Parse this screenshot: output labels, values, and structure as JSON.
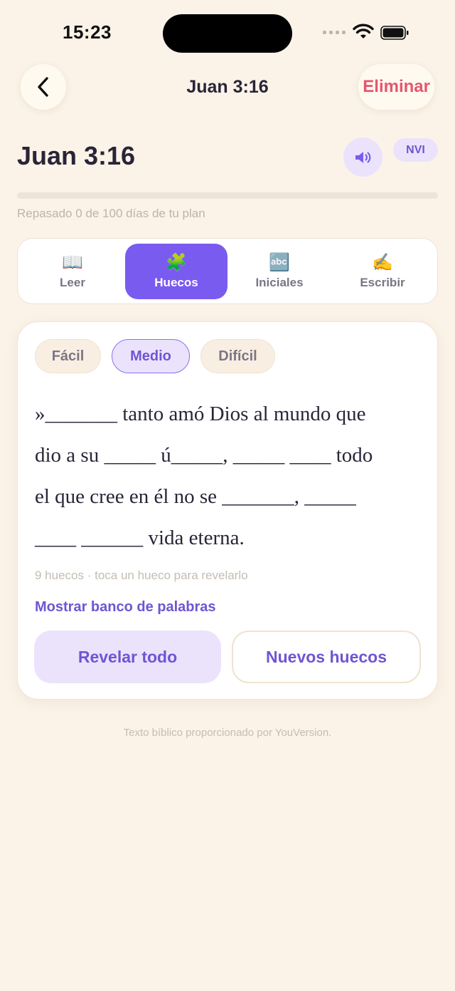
{
  "status_bar": {
    "time": "15:23"
  },
  "nav": {
    "title": "Juan 3:16",
    "delete_label": "Eliminar"
  },
  "heading": {
    "reference": "Juan 3:16",
    "version_badge": "NVI",
    "audio_icon": "speaker-icon"
  },
  "progress": {
    "reviewed_days": 0,
    "total_days": 100,
    "fraction": 0,
    "text": "Repasado 0 de 100 días de tu plan"
  },
  "mode_tabs": [
    {
      "icon": "📖",
      "icon_name": "book-icon",
      "label": "Leer",
      "active": false
    },
    {
      "icon": "🧩",
      "icon_name": "puzzle-icon",
      "label": "Huecos",
      "active": true
    },
    {
      "icon": "🔤",
      "icon_name": "abc-icon",
      "label": "Iniciales",
      "active": false
    },
    {
      "icon": "✍️",
      "icon_name": "writing-hand-icon",
      "label": "Escribir",
      "active": false
    }
  ],
  "difficulty": {
    "options": [
      "Fácil",
      "Medio",
      "Difícil"
    ],
    "selected": "Medio"
  },
  "verse_lines": [
    "»_______ tanto amó Dios al mundo que",
    "dio a su _____ ú_____, _____ ____ todo",
    "el que cree en él no se _______, _____",
    "____ ______ vida eterna."
  ],
  "blank_hint": "9 huecos · toca un hueco para revelarlo",
  "word_bank_link": "Mostrar banco de palabras",
  "buttons": {
    "reveal_all": "Revelar todo",
    "new_blanks": "Nuevos huecos"
  },
  "footer": "Texto bíblico proporcionado por YouVersion.",
  "colors": {
    "background": "#fbf3e8",
    "accent": "#7a5bf0",
    "accent_soft": "#ebe3fb",
    "danger": "#e5566e"
  }
}
